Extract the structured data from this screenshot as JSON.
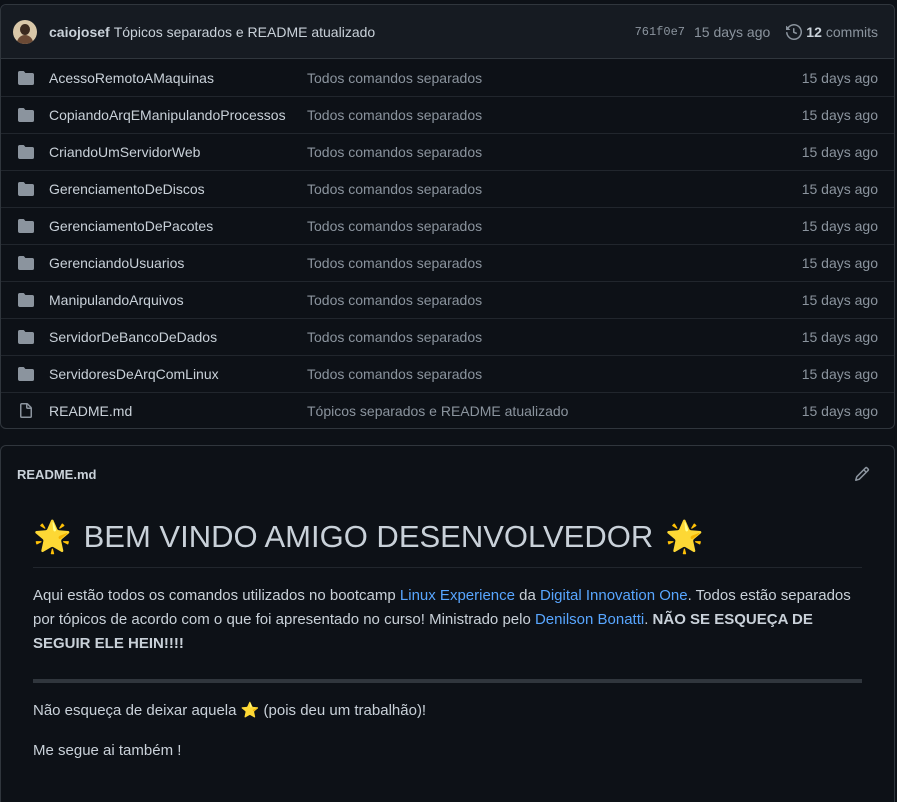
{
  "commit": {
    "author": "caiojosef",
    "message": "Tópicos separados e README atualizado",
    "sha": "761f0e7",
    "date": "15 days ago",
    "commits_count": "12",
    "commits_label": "commits"
  },
  "files": [
    {
      "type": "folder",
      "name": "AcessoRemotoAMaquinas",
      "message": "Todos comandos separados",
      "date": "15 days ago"
    },
    {
      "type": "folder",
      "name": "CopiandoArqEManipulandoProcessos",
      "message": "Todos comandos separados",
      "date": "15 days ago"
    },
    {
      "type": "folder",
      "name": "CriandoUmServidorWeb",
      "message": "Todos comandos separados",
      "date": "15 days ago"
    },
    {
      "type": "folder",
      "name": "GerenciamentoDeDiscos",
      "message": "Todos comandos separados",
      "date": "15 days ago"
    },
    {
      "type": "folder",
      "name": "GerenciamentoDePacotes",
      "message": "Todos comandos separados",
      "date": "15 days ago"
    },
    {
      "type": "folder",
      "name": "GerenciandoUsuarios",
      "message": "Todos comandos separados",
      "date": "15 days ago"
    },
    {
      "type": "folder",
      "name": "ManipulandoArquivos",
      "message": "Todos comandos separados",
      "date": "15 days ago"
    },
    {
      "type": "folder",
      "name": "ServidorDeBancoDeDados",
      "message": "Todos comandos separados",
      "date": "15 days ago"
    },
    {
      "type": "folder",
      "name": "ServidoresDeArqComLinux",
      "message": "Todos comandos separados",
      "date": "15 days ago"
    },
    {
      "type": "file",
      "name": "README.md",
      "message": "Tópicos separados e README atualizado",
      "date": "15 days ago"
    }
  ],
  "readme": {
    "title": "README.md",
    "heading": "BEM VINDO AMIGO DESENVOLVEDOR",
    "heading_emoji": "🌟",
    "p1_a": "Aqui estão todos os comandos utilizados no bootcamp ",
    "p1_link1": "Linux Experience",
    "p1_b": " da ",
    "p1_link2": "Digital Innovation One",
    "p1_c": ". Todos estão separados por tópicos de acordo com o que foi apresentado no curso! Ministrado pelo ",
    "p1_link3": "Denilson Bonatti",
    "p1_d": ". ",
    "p1_bold": "NÃO SE ESQUEÇA DE SEGUIR ELE HEIN!!!!",
    "p2_a": "Não esqueça de deixar aquela ",
    "p2_emoji": "⭐",
    "p2_b": " (pois deu um trabalhão)!",
    "p3": "Me segue ai também !"
  },
  "colors": {
    "accent": "#58a6ff",
    "bg": "#0d1117",
    "folder": "#8b949e"
  },
  "icons": {
    "folder": "folder-icon",
    "file": "file-icon",
    "history": "history-icon",
    "edit": "pencil-icon"
  }
}
